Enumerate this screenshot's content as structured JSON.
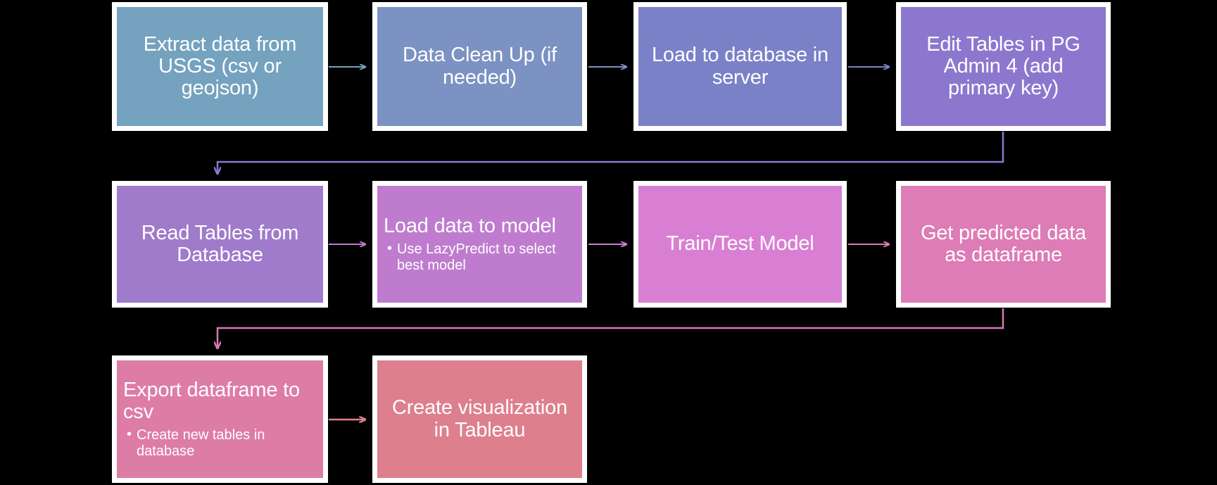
{
  "diagram": {
    "title": "Data pipeline workflow flowchart",
    "background_color": "#000000",
    "node_border_color": "#ffffff",
    "node_text_color": "#ffffff",
    "rows": [
      {
        "row_label": "row-1",
        "connector_color": "#8272c8",
        "nodes": [
          {
            "id": "extract-data",
            "title": "Extract data from USGS (csv or geojson)",
            "color": "#74a2bf",
            "align": "center",
            "bullets": []
          },
          {
            "id": "data-clean-up",
            "title": "Data Clean Up (if needed)",
            "color": "#7b92c2",
            "align": "center",
            "bullets": []
          },
          {
            "id": "load-to-database",
            "title": "Load to database in server",
            "color": "#7b81c7",
            "align": "center",
            "bullets": []
          },
          {
            "id": "edit-tables-pgadmin",
            "title": "Edit Tables in PG Admin 4 (add primary key)",
            "color": "#8c77ce",
            "align": "center",
            "bullets": []
          }
        ]
      },
      {
        "row_label": "row-2",
        "connector_color": "#d77ab5",
        "nodes": [
          {
            "id": "read-tables",
            "title": "Read Tables from Database",
            "color": "#a07acb",
            "align": "center",
            "bullets": []
          },
          {
            "id": "load-data-to-model",
            "title": "Load data to model",
            "color": "#bf7ccf",
            "align": "left",
            "bullets": [
              "Use LazyPredict to select best model"
            ]
          },
          {
            "id": "train-test-model",
            "title": "Train/Test Model",
            "color": "#d97fd3",
            "align": "center",
            "bullets": []
          },
          {
            "id": "get-predicted-data",
            "title": "Get predicted data as dataframe",
            "color": "#dd7cb6",
            "align": "center",
            "bullets": []
          }
        ]
      },
      {
        "row_label": "row-3",
        "connector_color": "#d9798f",
        "nodes": [
          {
            "id": "export-dataframe",
            "title": "Export dataframe to csv",
            "color": "#dd7ca5",
            "align": "left",
            "bullets": [
              "Create new tables in database"
            ]
          },
          {
            "id": "create-visualization",
            "title": "Create visualization in Tableau",
            "color": "#de7f8d",
            "align": "center",
            "bullets": []
          }
        ]
      }
    ],
    "arrows": [
      {
        "id": "arrow-extract-to-clean",
        "color": "#74a2bf"
      },
      {
        "id": "arrow-clean-to-load",
        "color": "#7b92c2"
      },
      {
        "id": "arrow-load-to-edit",
        "color": "#7b81c7"
      },
      {
        "id": "arrow-edit-to-read",
        "color": "#8c77ce"
      },
      {
        "id": "arrow-read-to-loadmodel",
        "color": "#bf7ccf"
      },
      {
        "id": "arrow-loadmodel-to-traintest",
        "color": "#cc7fd0"
      },
      {
        "id": "arrow-traintest-to-predicted",
        "color": "#dd7cb6"
      },
      {
        "id": "arrow-predicted-to-export",
        "color": "#d77ab5"
      },
      {
        "id": "arrow-export-to-visualization",
        "color": "#de7f8d"
      }
    ]
  }
}
